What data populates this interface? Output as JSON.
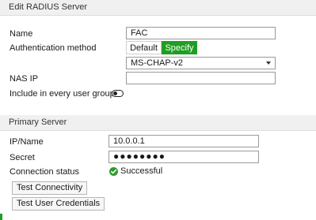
{
  "header": {
    "title": "Edit RADIUS Server"
  },
  "form": {
    "name_label": "Name",
    "name_value": "FAC",
    "auth_method_label": "Authentication method",
    "auth_options": [
      "Default",
      "Specify"
    ],
    "auth_selected": "Specify",
    "auth_protocol": "MS-CHAP-v2",
    "nas_ip_label": "NAS IP",
    "nas_ip_value": "",
    "include_label": "Include in every user group",
    "include_enabled": false
  },
  "primary": {
    "section_title": "Primary Server",
    "ip_label": "IP/Name",
    "ip_value": "10.0.0.1",
    "secret_label": "Secret",
    "secret_value": "●●●●●●●●",
    "conn_label": "Connection status",
    "conn_status": "Successful",
    "test_conn_button": "Test Connectivity",
    "test_cred_button": "Test User Credentials"
  },
  "colors": {
    "accent": "#1f9e22",
    "success": "#2a9d2a"
  }
}
